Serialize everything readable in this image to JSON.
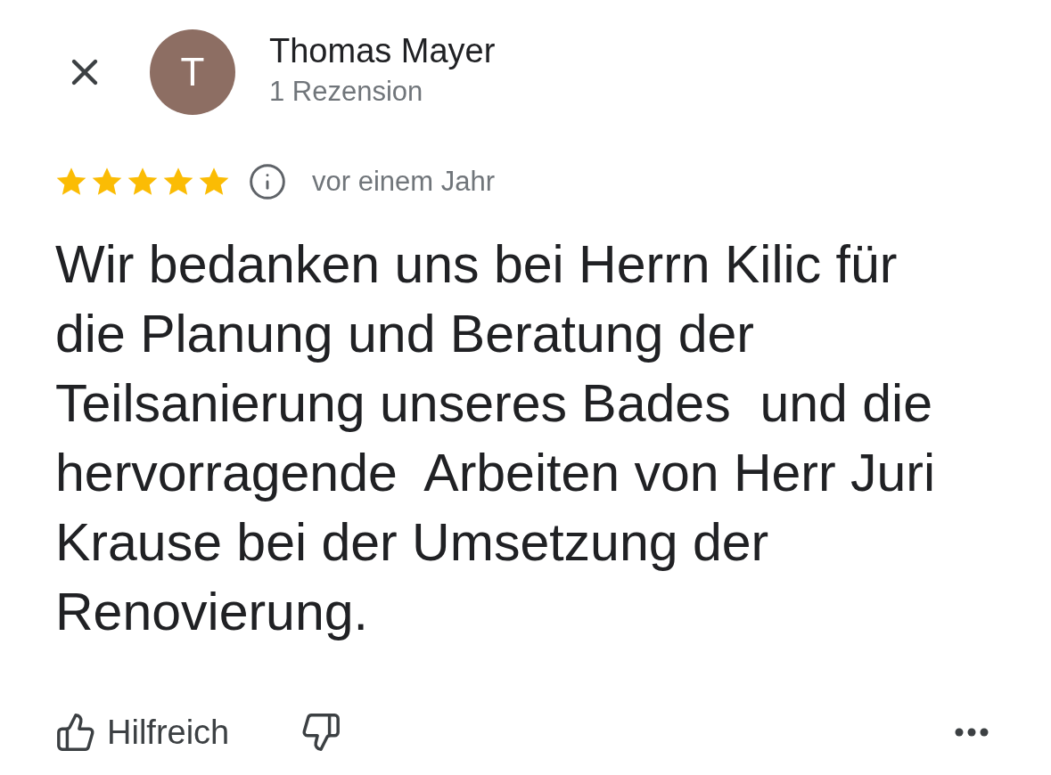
{
  "reviewer": {
    "avatar_letter": "T",
    "name": "Thomas Mayer",
    "review_count": "1 Rezension"
  },
  "rating": {
    "stars": 5,
    "time": "vor einem Jahr"
  },
  "review_text": "Wir bedanken uns bei Herrn Kilic für die Planung und Beratung der Teilsanierung unseres Bades  und die hervorragende  Arbeiten von Herr Juri Krause bei der Umsetzung der Renovierung.",
  "actions": {
    "helpful_label": "Hilfreich"
  }
}
